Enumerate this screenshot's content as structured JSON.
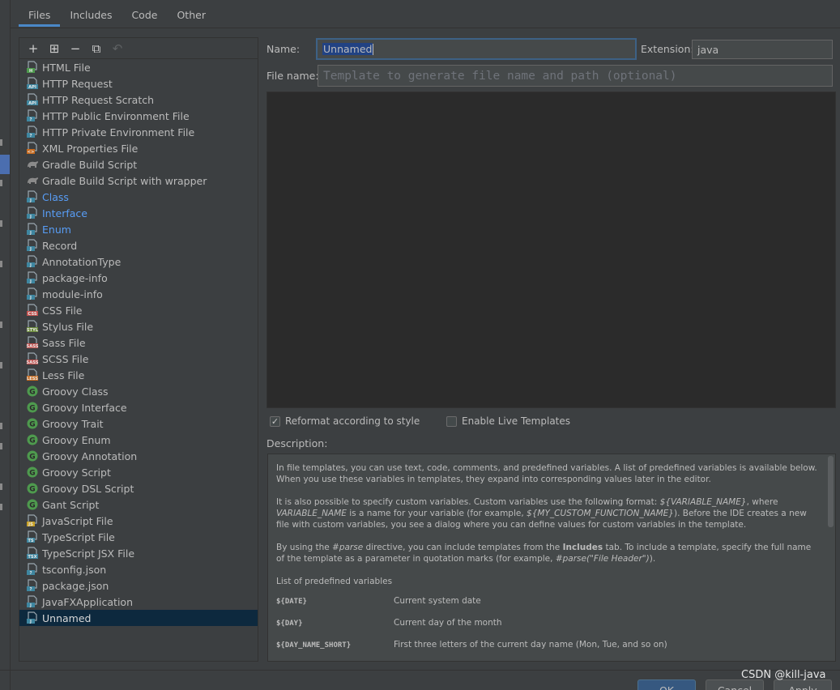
{
  "tabs": [
    "Files",
    "Includes",
    "Code",
    "Other"
  ],
  "toolbar": {
    "add": "+",
    "add_child": "⊞",
    "remove": "−",
    "copy": "⧉",
    "reset": "↶"
  },
  "templates": [
    {
      "label": "HTML File",
      "icon": "html-file-icon",
      "badge": "H",
      "badge_color": "#4e9a4e",
      "blue": false
    },
    {
      "label": "HTTP Request",
      "icon": "http-request-icon",
      "badge": "API",
      "badge_color": "#3e86a0",
      "blue": false
    },
    {
      "label": "HTTP Request Scratch",
      "icon": "http-scratch-icon",
      "badge": "API",
      "badge_color": "#3e86a0",
      "blue": false
    },
    {
      "label": "HTTP Public Environment File",
      "icon": "env-file-icon",
      "badge": "?",
      "badge_color": "#3e86a0",
      "blue": false
    },
    {
      "label": "HTTP Private Environment File",
      "icon": "env-file-icon",
      "badge": "?",
      "badge_color": "#3e86a0",
      "blue": false
    },
    {
      "label": "XML Properties File",
      "icon": "xml-file-icon",
      "badge": "<>",
      "badge_color": "#c76a1d",
      "blue": false
    },
    {
      "label": "Gradle Build Script",
      "icon": "gradle-icon",
      "badge": "",
      "badge_color": "#8a8a8a",
      "blue": false
    },
    {
      "label": "Gradle Build Script with wrapper",
      "icon": "gradle-icon",
      "badge": "",
      "badge_color": "#8a8a8a",
      "blue": false
    },
    {
      "label": "Class",
      "icon": "java-file-icon",
      "badge": "J",
      "badge_color": "#3e86a0",
      "blue": true
    },
    {
      "label": "Interface",
      "icon": "java-file-icon",
      "badge": "J",
      "badge_color": "#3e86a0",
      "blue": true
    },
    {
      "label": "Enum",
      "icon": "java-file-icon",
      "badge": "J",
      "badge_color": "#3e86a0",
      "blue": true
    },
    {
      "label": "Record",
      "icon": "java-file-icon",
      "badge": "J",
      "badge_color": "#3e86a0",
      "blue": false
    },
    {
      "label": "AnnotationType",
      "icon": "java-file-icon",
      "badge": "J",
      "badge_color": "#3e86a0",
      "blue": false
    },
    {
      "label": "package-info",
      "icon": "java-file-icon",
      "badge": "J",
      "badge_color": "#3e86a0",
      "blue": false
    },
    {
      "label": "module-info",
      "icon": "java-file-icon",
      "badge": "J",
      "badge_color": "#3e86a0",
      "blue": false
    },
    {
      "label": "CSS File",
      "icon": "css-file-icon",
      "badge": "CSS",
      "badge_color": "#c0504d",
      "blue": false
    },
    {
      "label": "Stylus File",
      "icon": "stylus-file-icon",
      "badge": "STYL",
      "badge_color": "#6a8a3a",
      "blue": false
    },
    {
      "label": "Sass File",
      "icon": "sass-file-icon",
      "badge": "SASS",
      "badge_color": "#c0504d",
      "blue": false
    },
    {
      "label": "SCSS File",
      "icon": "scss-file-icon",
      "badge": "SASS",
      "badge_color": "#c0504d",
      "blue": false
    },
    {
      "label": "Less File",
      "icon": "less-file-icon",
      "badge": "LESS",
      "badge_color": "#c76a1d",
      "blue": false
    },
    {
      "label": "Groovy Class",
      "icon": "groovy-icon",
      "badge": "G",
      "badge_color": "#4e9a4e",
      "blue": false
    },
    {
      "label": "Groovy Interface",
      "icon": "groovy-icon",
      "badge": "G",
      "badge_color": "#4e9a4e",
      "blue": false
    },
    {
      "label": "Groovy Trait",
      "icon": "groovy-icon",
      "badge": "G",
      "badge_color": "#4e9a4e",
      "blue": false
    },
    {
      "label": "Groovy Enum",
      "icon": "groovy-icon",
      "badge": "G",
      "badge_color": "#4e9a4e",
      "blue": false
    },
    {
      "label": "Groovy Annotation",
      "icon": "groovy-icon",
      "badge": "G",
      "badge_color": "#4e9a4e",
      "blue": false
    },
    {
      "label": "Groovy Script",
      "icon": "groovy-icon",
      "badge": "G",
      "badge_color": "#4e9a4e",
      "blue": false
    },
    {
      "label": "Groovy DSL Script",
      "icon": "groovy-icon",
      "badge": "G",
      "badge_color": "#4e9a4e",
      "blue": false
    },
    {
      "label": "Gant Script",
      "icon": "groovy-icon",
      "badge": "G",
      "badge_color": "#4e9a4e",
      "blue": false
    },
    {
      "label": "JavaScript File",
      "icon": "js-file-icon",
      "badge": "JS",
      "badge_color": "#c9a227",
      "blue": false
    },
    {
      "label": "TypeScript File",
      "icon": "ts-file-icon",
      "badge": "TS",
      "badge_color": "#3e86a0",
      "blue": false
    },
    {
      "label": "TypeScript JSX File",
      "icon": "tsx-file-icon",
      "badge": "TSX",
      "badge_color": "#3e86a0",
      "blue": false
    },
    {
      "label": "tsconfig.json",
      "icon": "json-file-icon",
      "badge": "?",
      "badge_color": "#3e86a0",
      "blue": false
    },
    {
      "label": "package.json",
      "icon": "json-file-icon",
      "badge": "?",
      "badge_color": "#3e86a0",
      "blue": false
    },
    {
      "label": "JavaFXApplication",
      "icon": "java-file-icon",
      "badge": "J",
      "badge_color": "#3e86a0",
      "blue": false
    },
    {
      "label": "Unnamed",
      "icon": "java-file-icon",
      "badge": "J",
      "badge_color": "#3e86a0",
      "blue": false,
      "selected": true
    }
  ],
  "form": {
    "name_label": "Name:",
    "name_value": "Unnamed",
    "extension_label": "Extension:",
    "extension_value": "java",
    "filename_label": "File name:",
    "filename_placeholder": "Template to generate file name and path (optional)"
  },
  "options": {
    "reformat_label": "Reformat according to style",
    "reformat_checked": true,
    "live_templates_label": "Enable Live Templates",
    "live_templates_checked": false
  },
  "description": {
    "label": "Description:",
    "p1": "In file templates, you can use text, code, comments, and predefined variables. A list of predefined variables is available below. When you use these variables in templates, they expand into corresponding values later in the editor.",
    "p2_a": "It is also possible to specify custom variables. Custom variables use the following format: ",
    "p2_var1": "${VARIABLE_NAME}",
    "p2_b": ", where ",
    "p2_var2": "VARIABLE_NAME",
    "p2_c": " is a name for your variable (for example, ",
    "p2_var3": "${MY_CUSTOM_FUNCTION_NAME}",
    "p2_d": "). Before the IDE creates a new file with custom variables, you see a dialog where you can define values for custom variables in the template.",
    "p3_a": "By using the ",
    "p3_parse": "#parse",
    "p3_b": " directive, you can include templates from the ",
    "p3_includes": "Includes",
    "p3_c": " tab. To include a template, specify the full name of the template as a parameter in quotation marks (for example, ",
    "p3_example": "#parse(\"File Header\")",
    "p3_d": ").",
    "list_title": "List of predefined variables",
    "variables": [
      {
        "name": "${DATE}",
        "desc": "Current system date"
      },
      {
        "name": "${DAY}",
        "desc": "Current day of the month"
      },
      {
        "name": "${DAY_NAME_SHORT}",
        "desc": "First three letters of the current day name (Mon, Tue, and so on)"
      }
    ]
  },
  "buttons": {
    "ok": "OK",
    "cancel": "Cancel",
    "apply": "Apply"
  },
  "watermark": "CSDN @kill-java",
  "colors": {
    "accent": "#4a88c7",
    "selection": "#0d293e",
    "link_blue": "#589df6",
    "primary_button": "#365880"
  }
}
